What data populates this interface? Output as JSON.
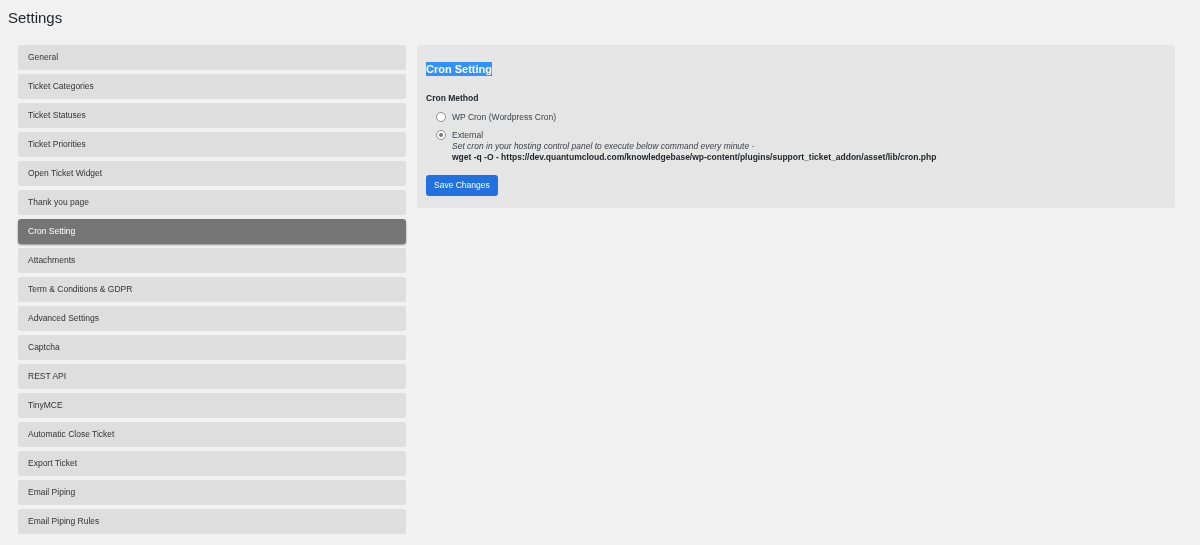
{
  "page_title": "Settings",
  "sidebar": {
    "items": [
      {
        "label": "General",
        "selected": false
      },
      {
        "label": "Ticket Categories",
        "selected": false
      },
      {
        "label": "Ticket Statuses",
        "selected": false
      },
      {
        "label": "Ticket Priorities",
        "selected": false
      },
      {
        "label": "Open Ticket Widget",
        "selected": false
      },
      {
        "label": "Thank you page",
        "selected": false
      },
      {
        "label": "Cron Setting",
        "selected": true
      },
      {
        "label": "Attachments",
        "selected": false
      },
      {
        "label": "Term & Conditions & GDPR",
        "selected": false
      },
      {
        "label": "Advanced Settings",
        "selected": false
      },
      {
        "label": "Captcha",
        "selected": false
      },
      {
        "label": "REST API",
        "selected": false
      },
      {
        "label": "TinyMCE",
        "selected": false
      },
      {
        "label": "Automatic Close Ticket",
        "selected": false
      },
      {
        "label": "Export Ticket",
        "selected": false
      },
      {
        "label": "Email Piping",
        "selected": false
      },
      {
        "label": "Email Piping Rules",
        "selected": false
      }
    ]
  },
  "panel": {
    "title": "Cron Setting",
    "title_highlighted": true,
    "field_label": "Cron Method",
    "options": [
      {
        "label": "WP Cron (Wordpress Cron)",
        "selected": false
      },
      {
        "label": "External",
        "selected": true,
        "hint": "Set cron in your hosting control panel to execute below command every minute -",
        "command": "wget -q -O - https://dev.quantumcloud.com/knowledgebase/wp-content/plugins/support_ticket_addon/asset/lib/cron.php"
      }
    ],
    "button": "Save Changes"
  }
}
